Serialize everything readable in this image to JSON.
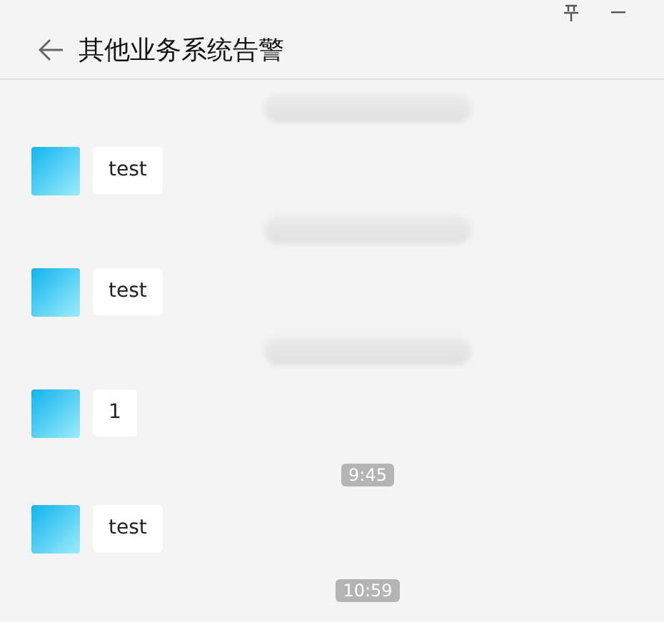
{
  "window": {
    "title": "其他业务系统告警"
  },
  "feed": [
    {
      "kind": "redacted"
    },
    {
      "kind": "message",
      "text": "test"
    },
    {
      "kind": "redacted"
    },
    {
      "kind": "message",
      "text": "test"
    },
    {
      "kind": "redacted"
    },
    {
      "kind": "message",
      "text": "1"
    },
    {
      "kind": "time",
      "text": "9:45"
    },
    {
      "kind": "message",
      "text": "test"
    },
    {
      "kind": "time",
      "text": "10:59"
    }
  ]
}
